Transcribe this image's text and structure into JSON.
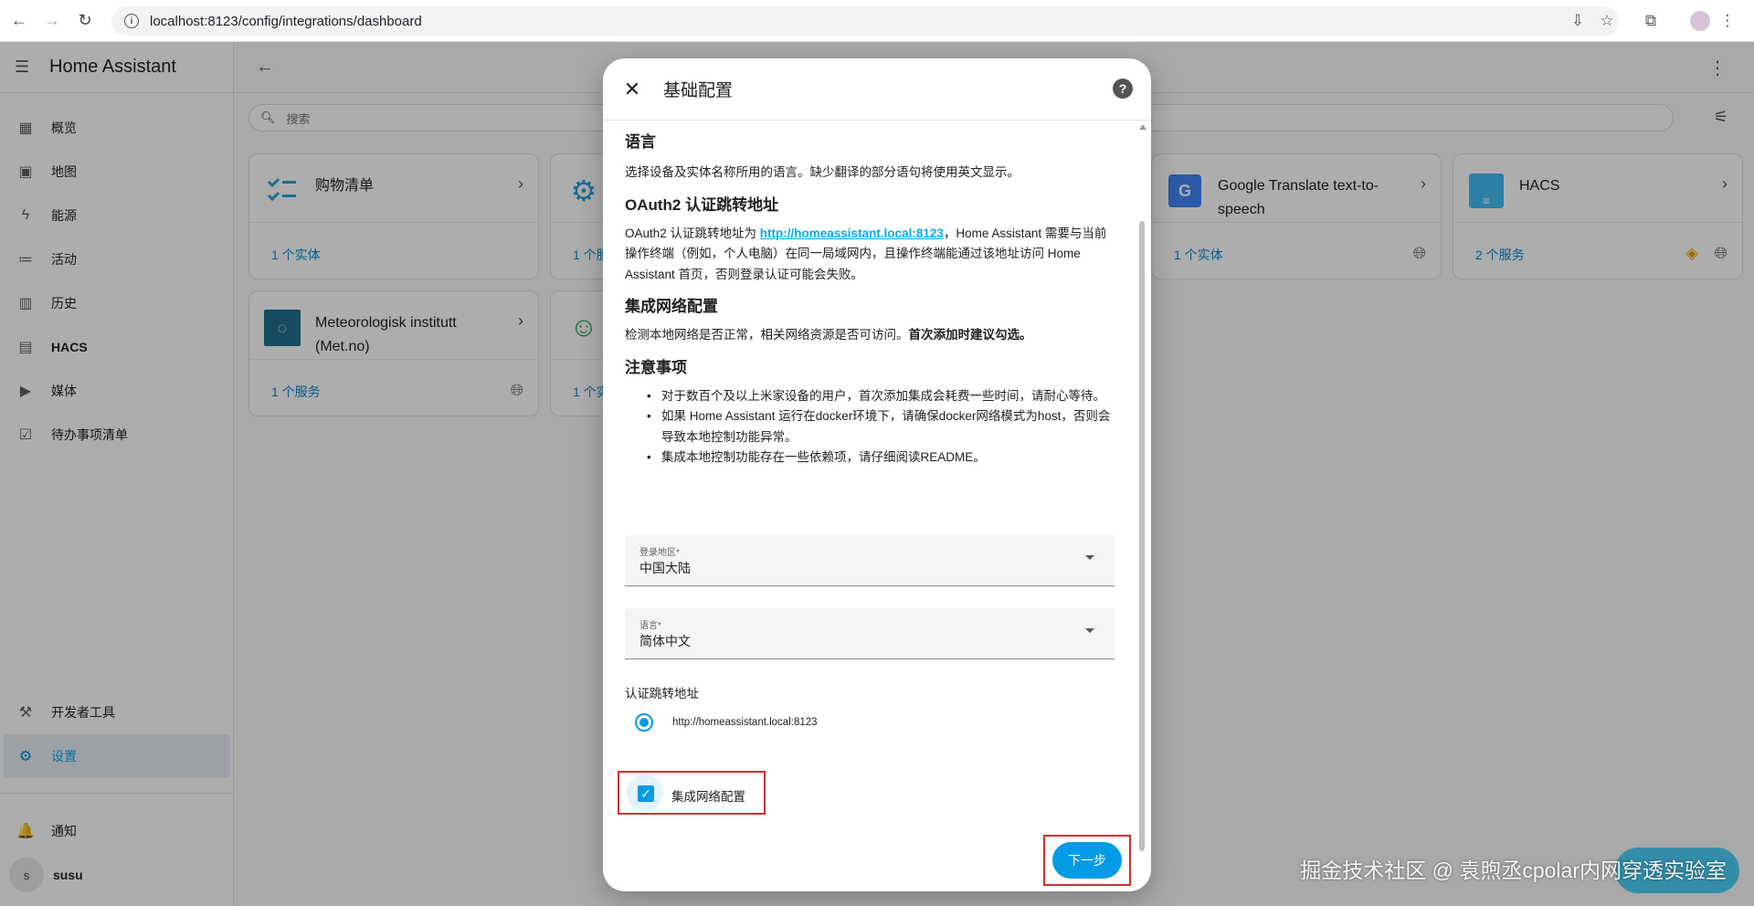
{
  "browser": {
    "url": "localhost:8123/config/integrations/dashboard"
  },
  "sidebar": {
    "title": "Home Assistant",
    "items": [
      {
        "label": "概览",
        "icon": "grid-icon"
      },
      {
        "label": "地图",
        "icon": "map-icon"
      },
      {
        "label": "能源",
        "icon": "lightning-icon"
      },
      {
        "label": "活动",
        "icon": "list-icon"
      },
      {
        "label": "历史",
        "icon": "chart-icon"
      },
      {
        "label": "HACS",
        "icon": "hacs-icon"
      },
      {
        "label": "媒体",
        "icon": "media-icon"
      },
      {
        "label": "待办事项清单",
        "icon": "clipboard-icon"
      }
    ],
    "dev_tools": "开发者工具",
    "settings": "设置",
    "notifications": "通知",
    "user_initial": "s",
    "user_name": "susu"
  },
  "main": {
    "search_placeholder": "搜索",
    "cards": [
      {
        "title": "购物清单",
        "link": "1 个实体"
      },
      {
        "title": "Google Translate text-to-speech",
        "link": "1 个实体"
      },
      {
        "title": "HACS",
        "link": "2 个服务"
      },
      {
        "title": "Meteorologisk institutt (Met.no)",
        "link": "1 个服务"
      }
    ],
    "partial_card_links": [
      "1 个服",
      "1 个实"
    ]
  },
  "dialog": {
    "title": "基础配置",
    "section_language_title": "语言",
    "section_language_text": "选择设备及实体名称所用的语言。缺少翻译的部分语句将使用英文显示。",
    "section_oauth_title": "OAuth2 认证跳转地址",
    "oauth_text_prefix": "OAuth2 认证跳转地址为 ",
    "oauth_link": "http://homeassistant.local:8123",
    "oauth_text_suffix": "，Home Assistant 需要与当前操作终端（例如，个人电脑）在同一局域网内，且操作终端能通过该地址访问 Home Assistant 首页，否则登录认证可能会失败。",
    "section_network_title": "集成网络配置",
    "network_text": "检测本地网络是否正常，相关网络资源是否可访问。",
    "network_text_bold": "首次添加时建议勾选。",
    "section_notes_title": "注意事项",
    "notes": [
      "对于数百个及以上米家设备的用户，首次添加集成会耗费一些时间，请耐心等待。",
      "如果 Home Assistant 运行在docker环境下，请确保docker网络模式为host，否则会导致本地控制功能异常。",
      "集成本地控制功能存在一些依赖项，请仔细阅读README。"
    ],
    "region_label": "登录地区*",
    "region_value": "中国大陆",
    "lang_label": "语言*",
    "lang_value": "简体中文",
    "redirect_label": "认证跳转地址",
    "redirect_option": "http://homeassistant.local:8123",
    "checkbox_label": "集成网络配置",
    "next_button": "下一步"
  },
  "watermark": "掘金技术社区 @ 袁煦丞cpolar内网穿透实验室",
  "colors": {
    "accent": "#039be5",
    "highlight_border": "#d32f2f"
  }
}
